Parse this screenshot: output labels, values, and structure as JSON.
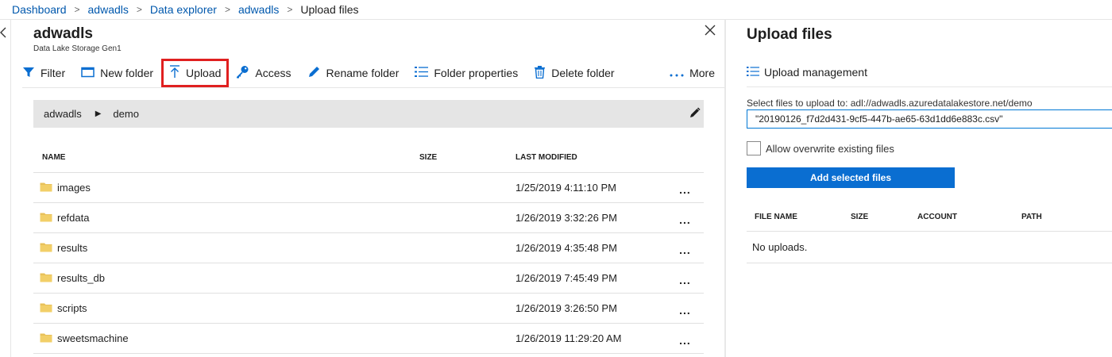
{
  "breadcrumb": {
    "items": [
      "Dashboard",
      "adwadls",
      "Data explorer",
      "adwadls"
    ],
    "current": "Upload files"
  },
  "explorer": {
    "title": "adwadls",
    "subtitle": "Data Lake Storage Gen1",
    "toolbar": {
      "filter": "Filter",
      "new_folder": "New folder",
      "upload": "Upload",
      "access": "Access",
      "rename_folder": "Rename folder",
      "folder_properties": "Folder properties",
      "delete_folder": "Delete folder",
      "more": "More"
    },
    "path": {
      "root": "adwadls",
      "folder": "demo"
    },
    "table": {
      "columns": [
        "NAME",
        "SIZE",
        "LAST MODIFIED"
      ],
      "rows": [
        {
          "name": "images",
          "size": "",
          "modified": "1/25/2019 4:11:10 PM",
          "actions": "..."
        },
        {
          "name": "refdata",
          "size": "",
          "modified": "1/26/2019 3:32:26 PM",
          "actions": "..."
        },
        {
          "name": "results",
          "size": "",
          "modified": "1/26/2019 4:35:48 PM",
          "actions": "..."
        },
        {
          "name": "results_db",
          "size": "",
          "modified": "1/26/2019 7:45:49 PM",
          "actions": "..."
        },
        {
          "name": "scripts",
          "size": "",
          "modified": "1/26/2019 3:26:50 PM",
          "actions": "..."
        },
        {
          "name": "sweetsmachine",
          "size": "",
          "modified": "1/26/2019 11:29:20 AM",
          "actions": "..."
        }
      ]
    }
  },
  "upload": {
    "title": "Upload files",
    "management": "Upload management",
    "select_label": "Select files to upload to: adl://adwadls.azuredatalakestore.net/demo",
    "selected_file": "\"20190126_f7d2d431-9cf5-447b-ae65-63d1dd6e883c.csv\"",
    "overwrite_label": "Allow overwrite existing files",
    "overwrite_checked": false,
    "add_button": "Add selected files",
    "columns": [
      "FILE NAME",
      "SIZE",
      "ACCOUNT",
      "PATH"
    ],
    "empty_message": "No uploads."
  },
  "colors": {
    "link": "#0058ad",
    "accent": "#0078d4",
    "primary_button": "#0a6ed1",
    "highlight": "#e02020",
    "folder": "#e8c15a"
  }
}
